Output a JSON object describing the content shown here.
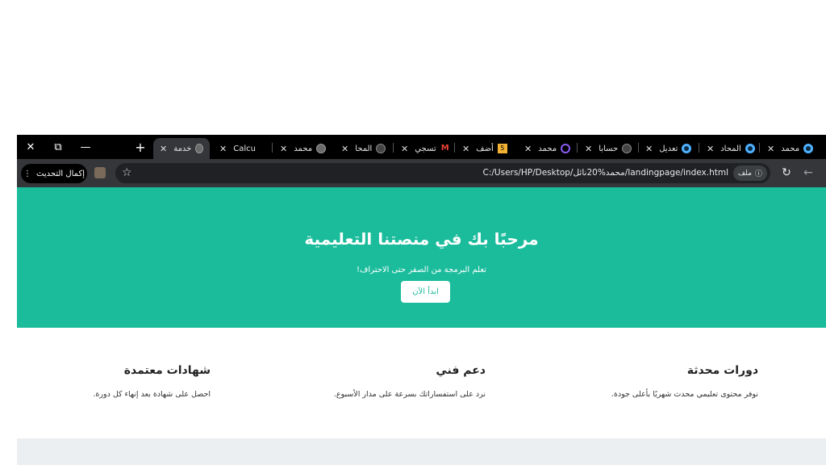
{
  "window": {
    "close_glyph": "✕",
    "restore_glyph": "⧉",
    "minimize_glyph": "—",
    "new_tab_glyph": "+"
  },
  "tabs": [
    {
      "title": "خدمة",
      "icon": "globe-icon",
      "active": true
    },
    {
      "title": "Calcu",
      "icon": "globe-icon",
      "active": false
    },
    {
      "title": "محمد",
      "icon": "globe-icon",
      "active": false
    },
    {
      "title": "المحا",
      "icon": "github-icon",
      "active": false
    },
    {
      "title": "تسجي",
      "icon": "gmail-icon",
      "active": false
    },
    {
      "title": "أضف",
      "icon": "number-badge-icon",
      "badge": "5",
      "active": false
    },
    {
      "title": "محمد",
      "icon": "purple-ring-icon",
      "active": false
    },
    {
      "title": "حسابا",
      "icon": "github-icon",
      "active": false
    },
    {
      "title": "تعديل",
      "icon": "ring-icon",
      "active": false
    },
    {
      "title": "المحاد",
      "icon": "ring-icon",
      "active": false
    },
    {
      "title": "محمد",
      "icon": "ring-icon",
      "active": false
    }
  ],
  "tab_close_glyph": "✕",
  "toolbar": {
    "update_button": "إكمال التحديث",
    "update_menu_glyph": "⋮",
    "star_glyph": "☆",
    "url": "C:/Users/HP/Desktop/محمد%20نائل/landingpage/index.html",
    "site_chip": "ملف",
    "info_glyph": "ⓘ",
    "reload_glyph": "↻",
    "back_glyph": "←"
  },
  "hero": {
    "title": "مرحبًا بك في منصتنا التعليمية",
    "subtitle": "تعلم البرمجة من الصفر حتى الاحتراف!",
    "cta": "ابدأ الآن"
  },
  "features": [
    {
      "title": "دورات محدثة",
      "text": "نوفر محتوى تعليمي محدث شهريًا بأعلى جودة."
    },
    {
      "title": "دعم فني",
      "text": "نرد على استفساراتك بسرعة على مدار الأسبوع."
    },
    {
      "title": "شهادات معتمدة",
      "text": "احصل على شهادة بعد إنهاء كل دورة."
    }
  ],
  "colors": {
    "hero_bg": "#1abc9c",
    "footer_band": "#eceff1",
    "tabstrip_bg": "#000000",
    "toolbar_bg": "#35363a"
  }
}
